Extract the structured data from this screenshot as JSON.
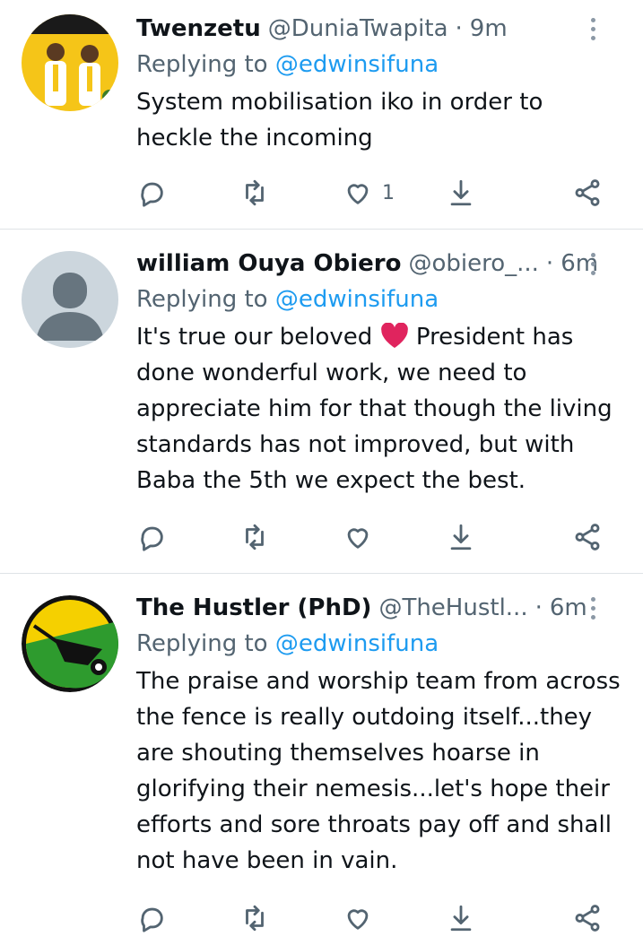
{
  "tweets": [
    {
      "name": "Twenzetu",
      "handle": "@DuniaTwapita",
      "time": "9m",
      "replying_prefix": "Replying to ",
      "replying_to": "@edwinsifuna",
      "text": "System mobilisation iko in order to heckle the incoming",
      "likes": "1",
      "avatar": "avatar-campaign-poster"
    },
    {
      "name": "william Ouya Obiero",
      "handle": "@obiero_...",
      "time": "6m",
      "replying_prefix": "Replying to ",
      "replying_to": "@edwinsifuna",
      "text_before": "It's true our  beloved ",
      "text_after": " President has done wonderful work, we need to appreciate him for that though the living standards has not improved, but with Baba the 5th we expect the best.",
      "emoji": "red-heart",
      "likes": "",
      "avatar": "avatar-default-silhouette"
    },
    {
      "name": "The Hustler (PhD)",
      "handle": "@TheHustl...",
      "time": "6m",
      "replying_prefix": "Replying to ",
      "replying_to": "@edwinsifuna",
      "text": "The praise and worship team from across the fence is really outdoing itself...they are shouting themselves hoarse in glorifying their nemesis...let's hope their efforts and sore throats pay off and shall not have been in vain.",
      "likes": "",
      "avatar": "avatar-wheelbarrow-logo"
    }
  ],
  "colors": {
    "link": "#1d9bf0",
    "muted": "#536471",
    "heart": "#e0245e"
  }
}
